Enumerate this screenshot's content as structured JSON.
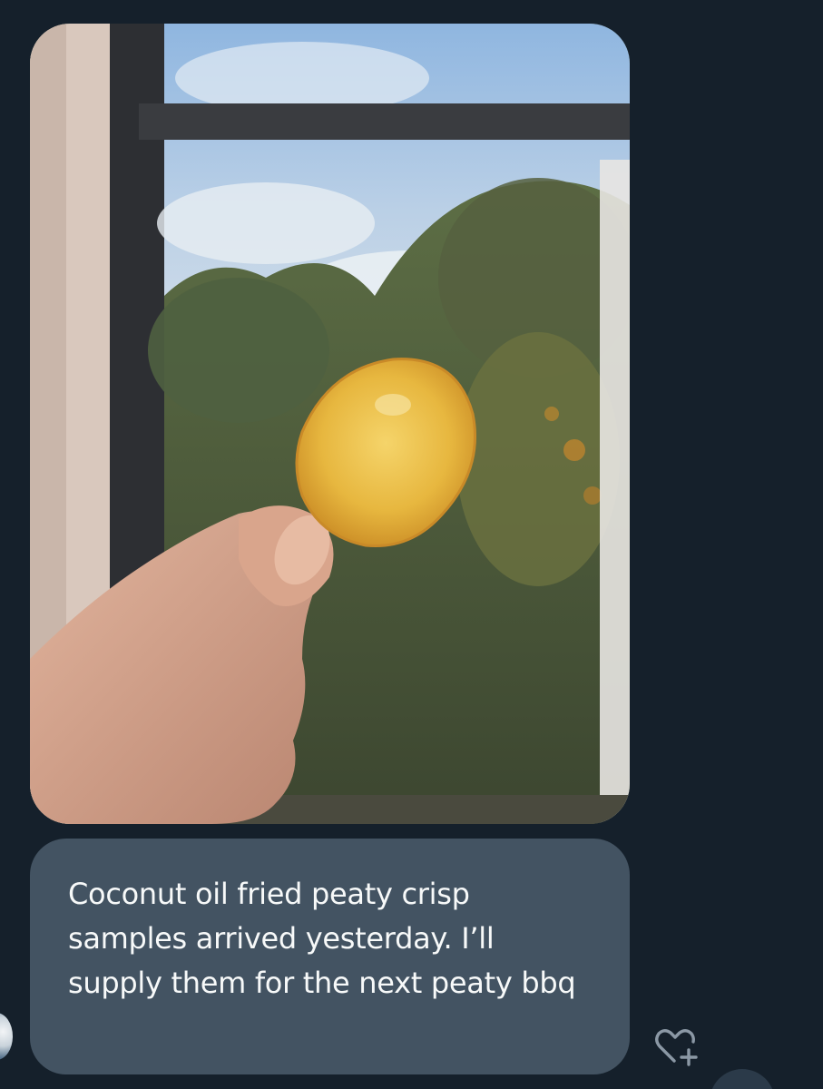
{
  "conversation": {
    "messages": [
      {
        "type": "image",
        "alt": "photo of a crisp"
      },
      {
        "type": "text",
        "text": "Coconut oil fried peaty crisp samples arrived yesterday. I’ll supply them for the next peaty bbq"
      }
    ]
  },
  "icons": {
    "react": "heart-plus-icon"
  },
  "colors": {
    "background": "#15202b",
    "bubble": "#435362",
    "text": "#f7f9f9",
    "icon": "#8b98a5"
  }
}
